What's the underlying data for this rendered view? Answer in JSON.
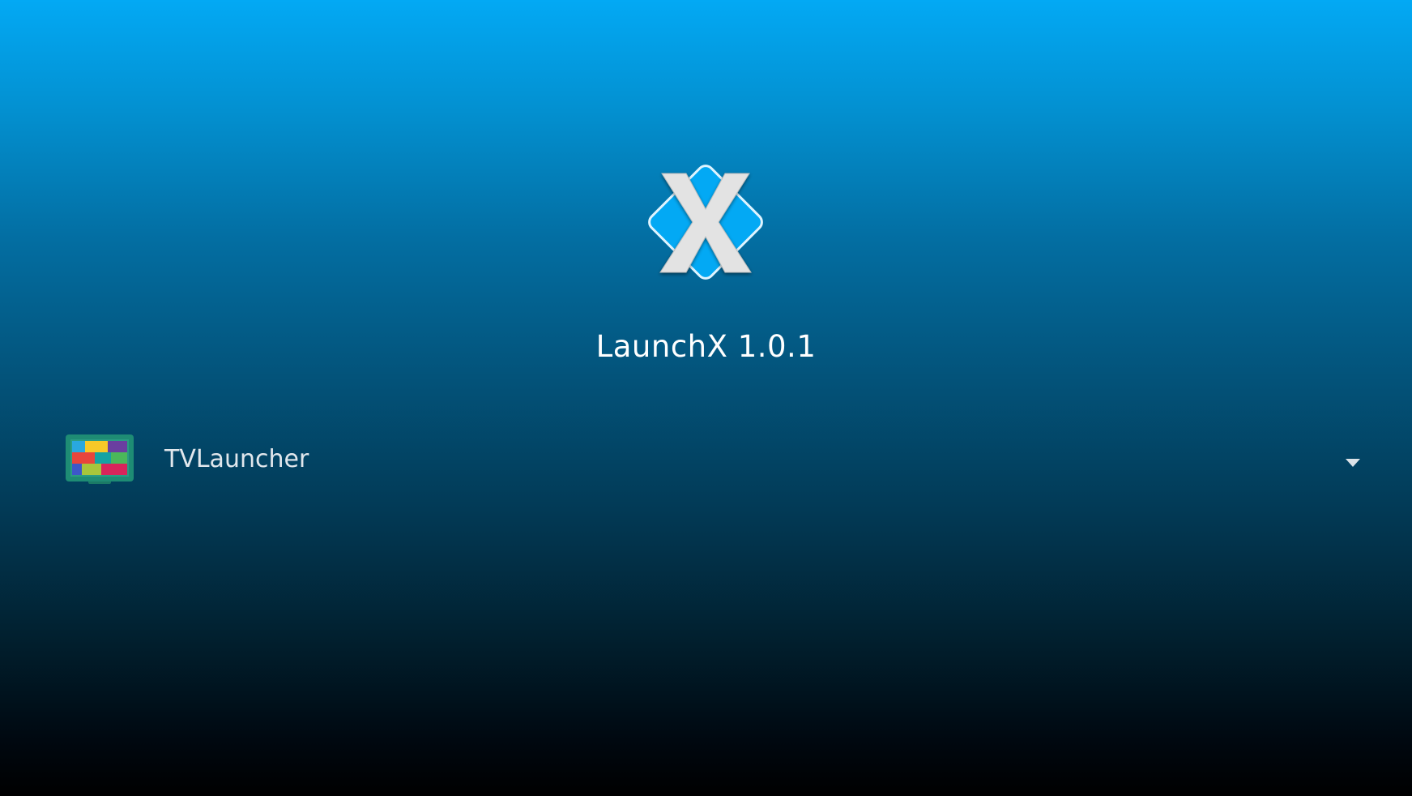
{
  "app": {
    "title": "LaunchX 1.0.1",
    "logo_icon": "launchx-logo-icon"
  },
  "launcher_selector": {
    "icon": "tv-launcher-app-icon",
    "selected_value": "TVLauncher",
    "dropdown_icon": "caret-down-icon"
  },
  "colors": {
    "logo_diamond": "#03a9f4",
    "logo_x": "#e6e6e6",
    "gradient_top": "#03a9f4",
    "gradient_bottom": "#000000"
  }
}
